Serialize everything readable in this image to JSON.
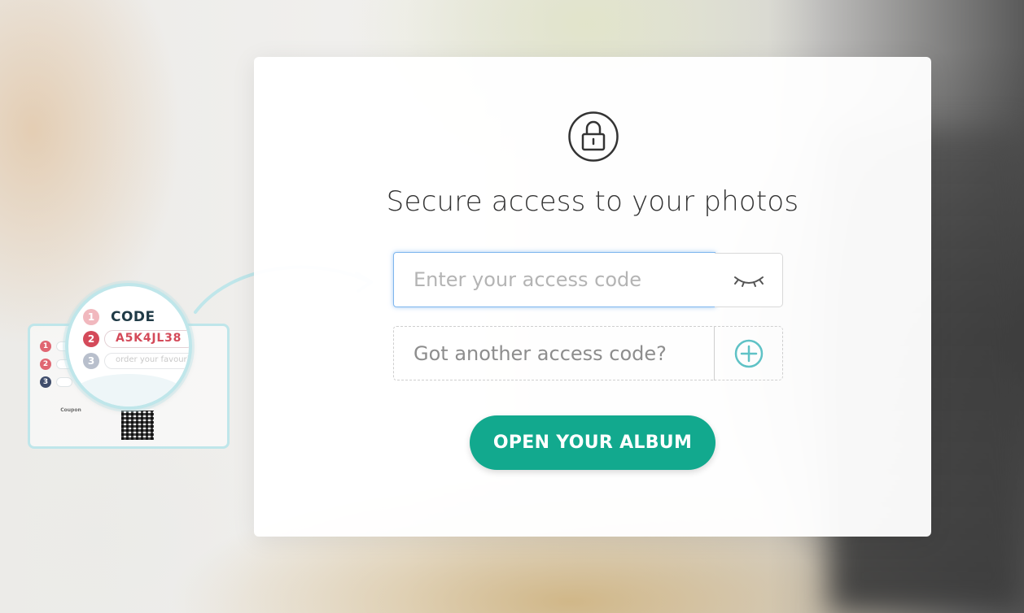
{
  "modal": {
    "title": "Secure access to your photos",
    "access_code_placeholder": "Enter your access code",
    "another_code_placeholder": "Got another access code?",
    "open_button_label": "OPEN YOUR ALBUM",
    "icons": {
      "lock": "lock-icon",
      "toggle_visibility": "eye-closed-icon",
      "add": "plus-circle-icon"
    }
  },
  "illustration": {
    "code_label": "CODE",
    "code_value": "A5K4JL38",
    "placeholder_text": "order your favourite",
    "steps": [
      "1",
      "2",
      "3"
    ],
    "coupon_title": "Coupon"
  },
  "colors": {
    "primary_button": "#12a98e",
    "focus_border": "#7fb6ee",
    "add_icon": "#5fc2c6",
    "code_value": "#d44a5a",
    "illustration_accent": "#bfe6ea"
  }
}
